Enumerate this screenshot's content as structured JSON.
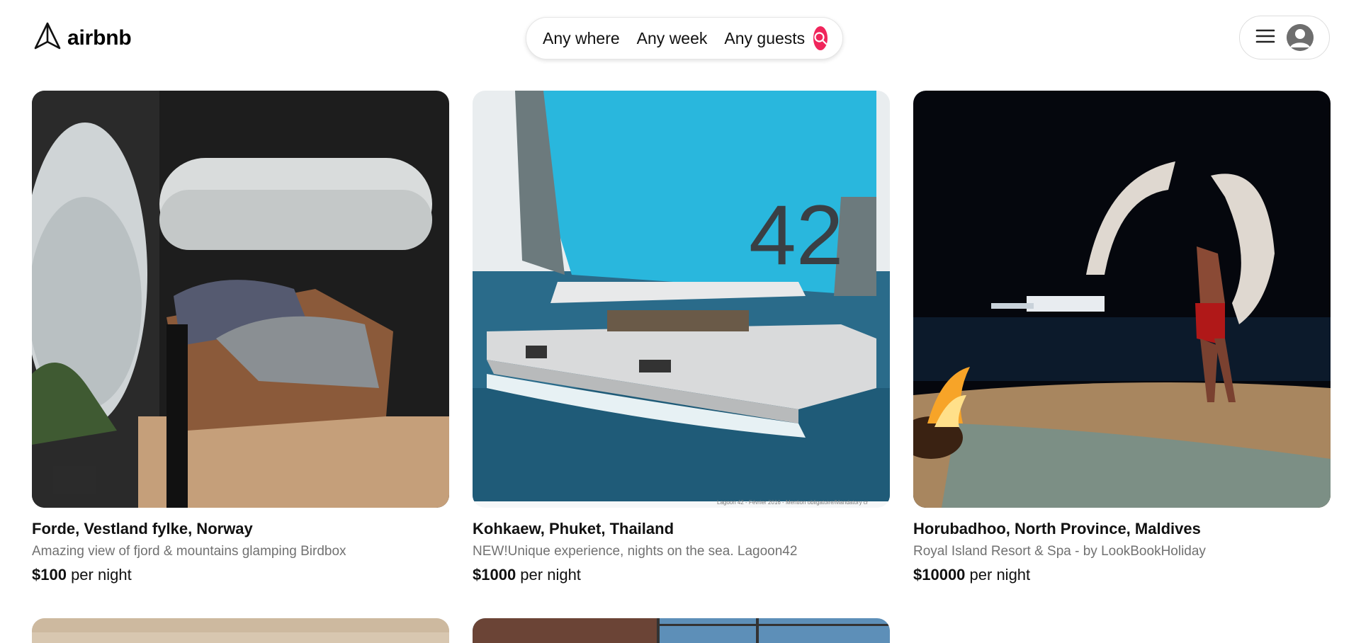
{
  "brand": {
    "name": "airbnb",
    "icon": "paper-plane-logo-icon"
  },
  "search": {
    "where": "Any where",
    "when": "Any week",
    "who": "Any guests",
    "button_icon": "search-icon",
    "accent": "#f0255b"
  },
  "user_menu": {
    "menu_icon": "hamburger-icon",
    "avatar_icon": "user-avatar-icon"
  },
  "listings": [
    {
      "location": "Forde, Vestland fylke, Norway",
      "description": "Amazing view of fjord & mountains glamping Birdbox",
      "price": "$100",
      "price_suffix": " per night"
    },
    {
      "location": "Kohkaew, Phuket, Thailand",
      "description": "NEW!Unique experience, nights on the sea. Lagoon42",
      "price": "$1000",
      "price_suffix": " per night",
      "image_text": "42",
      "image_caption": "Lagoon 42 - Février 2016 - Mention obligatoire/Mandatory cr"
    },
    {
      "location": "Horubadhoo, North Province, Maldives",
      "description": "Royal Island Resort & Spa - by LookBookHoliday",
      "price": "$10000",
      "price_suffix": " per night"
    },
    {
      "location": "",
      "description": "",
      "price": "",
      "price_suffix": ""
    },
    {
      "location": "",
      "description": "",
      "price": "",
      "price_suffix": ""
    }
  ]
}
